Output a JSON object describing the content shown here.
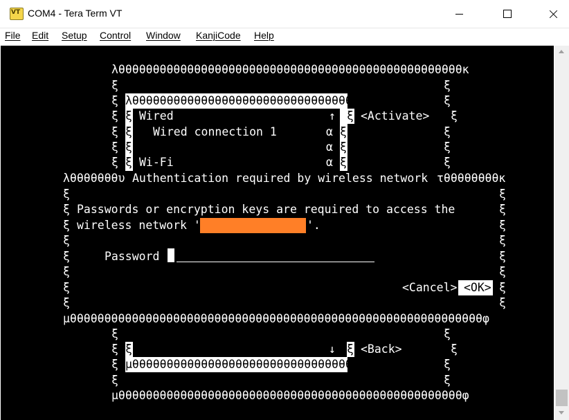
{
  "window": {
    "title": "COM4 - Tera Term VT"
  },
  "menu": [
    "File",
    "Edit",
    "Setup",
    "Control",
    "Window",
    "KanjiCode",
    "Help"
  ],
  "terminal": {
    "outer_top": "λθθθθθθθθθθθθθθθθθθθθθθθθθθθθθθθθθθθθθθθθθθθθθθθθθθκ",
    "side_glyph": "ξ",
    "list_top": "λθθθθθθθθθθθθθθθθθθθθθθθθθθθθθθθθθκ",
    "list_bottom": "μθθθθθθθθθθθθθθθθθθθθθθθθθθθθθθθθθφ",
    "wired": "Wired",
    "wired_conn": "Wired connection 1",
    "wifi": "Wi-Fi",
    "scroll_up": "↑",
    "scroll_down": "↓",
    "scroll_mark": "α",
    "activate": "<Activate>",
    "back": "<Back>",
    "dialog_left_edge": "λθθθθθθθυ",
    "dialog_title": "Authentication required by wireless network",
    "dialog_right_edge": "τθθθθθθθθκ",
    "message_line1": "Passwords or encryption keys are required to access the",
    "message_line2_prefix": "wireless network '",
    "message_line2_suffix": "'.",
    "password_label": "Password",
    "cancel": "<Cancel>",
    "ok": "<OK>",
    "dialog_bottom": "μθθθθθθθθθθθθθθθθθθθθθθθθθθθθθθθθθθθθθθθθθθθθθθθθθθθθθθθθθθθθφ",
    "outer_bottom": "μθθθθθθθθθθθθθθθθθθθθθθθθθθθθθθθθθθθθθθθθθθθθθθθθθθφ"
  }
}
